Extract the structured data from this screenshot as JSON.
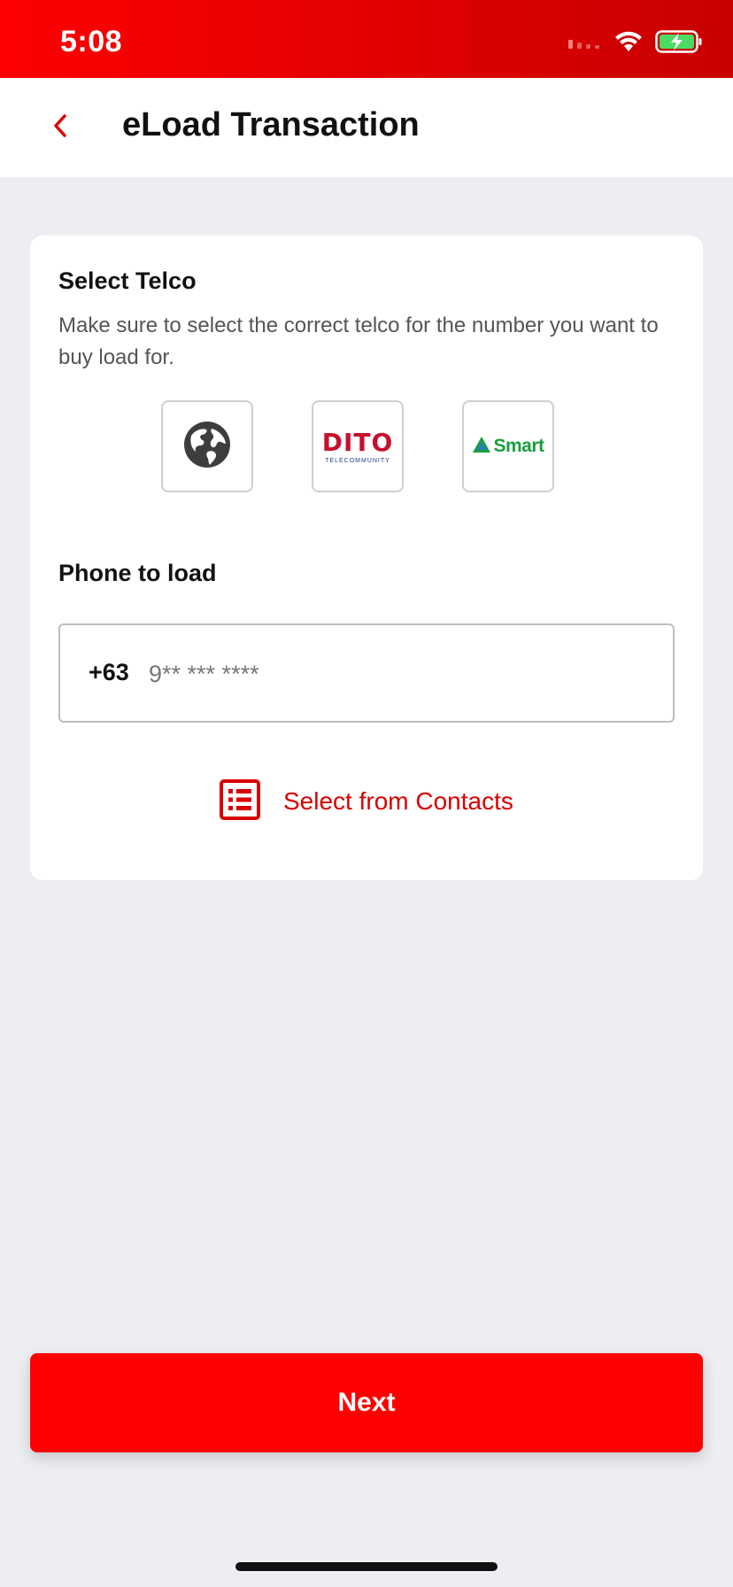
{
  "status_bar": {
    "time": "5:08",
    "icons": [
      "cellular-signal-icon",
      "wifi-icon",
      "battery-charging-icon"
    ]
  },
  "header": {
    "back_icon": "chevron-left-icon",
    "title": "eLoad Transaction"
  },
  "telco_section": {
    "title": "Select Telco",
    "description": "Make sure to select the correct telco for the number you want to buy load for.",
    "options": [
      {
        "icon": "globe-icon"
      },
      {
        "logo_word": "DITO",
        "logo_sub": "TELECOMMUNITY"
      },
      {
        "logo_word": "Smart"
      }
    ]
  },
  "phone_section": {
    "title": "Phone to load",
    "country_code": "+63",
    "input_value": "",
    "input_placeholder": "9** *** ****"
  },
  "contacts": {
    "label": "Select from Contacts",
    "icon": "list-icon"
  },
  "next_button": {
    "label": "Next"
  },
  "colors": {
    "accent": "#ff0000",
    "link": "#d80000",
    "background": "#edeef1",
    "dito": "#c8102e",
    "smart": "#1a9e3f"
  }
}
